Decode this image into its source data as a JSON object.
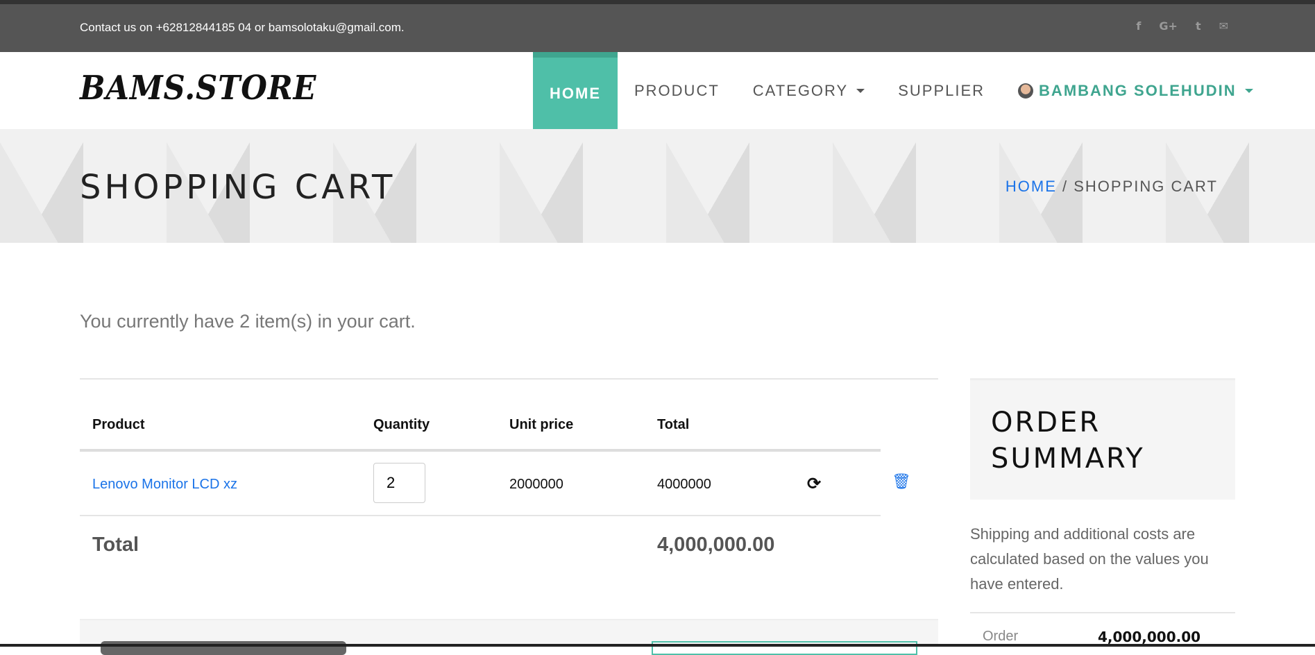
{
  "topbar": {
    "contact": "Contact us on +62812844185 04 or bamsolotaku@gmail.com.",
    "social": [
      "f",
      "G+",
      "t",
      "✉"
    ]
  },
  "brand": {
    "logo": "BAMS.STORE"
  },
  "nav": {
    "home": "HOME",
    "product": "PRODUCT",
    "category": "CATEGORY",
    "supplier": "SUPPLIER",
    "user": "BAMBANG SOLEHUDIN"
  },
  "banner": {
    "title": "SHOPPING CART",
    "crumb_home": "HOME",
    "crumb_sep": "/",
    "crumb_current": "SHOPPING CART"
  },
  "cart": {
    "intro": "You currently have 2 item(s) in your cart.",
    "headers": {
      "product": "Product",
      "quantity": "Quantity",
      "unit_price": "Unit price",
      "total": "Total"
    },
    "items": [
      {
        "product": "Lenovo Monitor LCD xz",
        "quantity": "2",
        "unit_price": "2000000",
        "total": "4000000"
      }
    ],
    "total_label": "Total",
    "total_value": "4,000,000.00"
  },
  "summary": {
    "title": "ORDER SUMMARY",
    "note": "Shipping and additional costs are calculated based on the values you have entered.",
    "order_label": "Order",
    "order_value": "4,000,000.00"
  },
  "colors": {
    "accent": "#4fbfa8",
    "link": "#1a73e8"
  }
}
